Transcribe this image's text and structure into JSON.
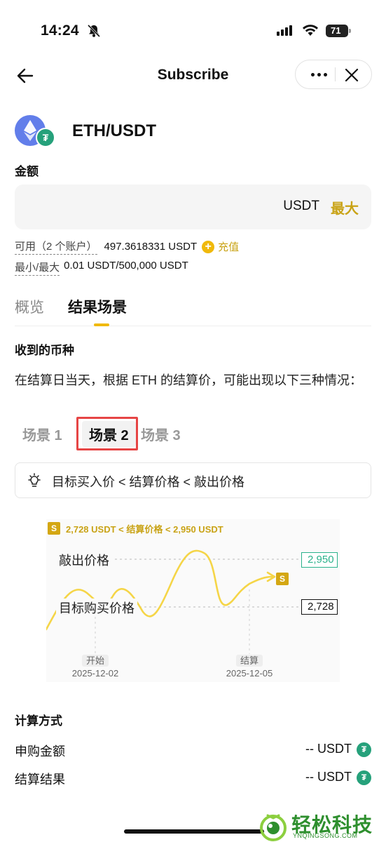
{
  "status_bar": {
    "time": "14:24",
    "battery": "71"
  },
  "nav": {
    "title": "Subscribe"
  },
  "pair": {
    "name": "ETH/USDT",
    "badge_glyph": "₮"
  },
  "amount": {
    "label": "金额",
    "placeholder": "",
    "unit": "USDT",
    "max_label": "最大"
  },
  "available": {
    "label": "可用（2 个账户）",
    "value": "497.3618331 USDT",
    "plus_glyph": "+",
    "charge_label": "充值"
  },
  "limits": {
    "label": "最小/最大",
    "value": "0.01 USDT/500,000 USDT"
  },
  "tabs": [
    {
      "label": "概览",
      "active": false
    },
    {
      "label": "结果场景",
      "active": true
    }
  ],
  "received": {
    "title": "收到的币种"
  },
  "description": "在结算日当天，根据 ETH 的结算价，可能出现以下三种情况：",
  "scenarios": [
    {
      "label": "场景 1",
      "active": false
    },
    {
      "label": "场景 2",
      "active": true
    },
    {
      "label": "场景 3",
      "active": false
    }
  ],
  "condition": {
    "text": "目标买入价 < 结算价格 < 敲出价格"
  },
  "chart": {
    "badge": "S",
    "range_text": "2,728 USDT < 结算价格 < 2,950 USDT",
    "knock_out_label": "敲出价格",
    "knock_out_value": "2,950",
    "target_label": "目标购买价格",
    "target_value": "2,728",
    "start_label": "开始",
    "start_date": "2025-12-02",
    "settle_label": "结算",
    "settle_date": "2025-12-05",
    "colors": {
      "curve": "#f5d547",
      "high": "#2ab28b",
      "badge": "#d4a713"
    }
  },
  "calc": {
    "title": "计算方式",
    "rows": [
      {
        "label": "申购金额",
        "value": "-- USDT"
      },
      {
        "label": "结算结果",
        "value": "-- USDT"
      }
    ],
    "coin_glyph": "₮"
  },
  "watermark": {
    "brand": "轻松科技",
    "domain": "YNQINGSONG.COM"
  }
}
